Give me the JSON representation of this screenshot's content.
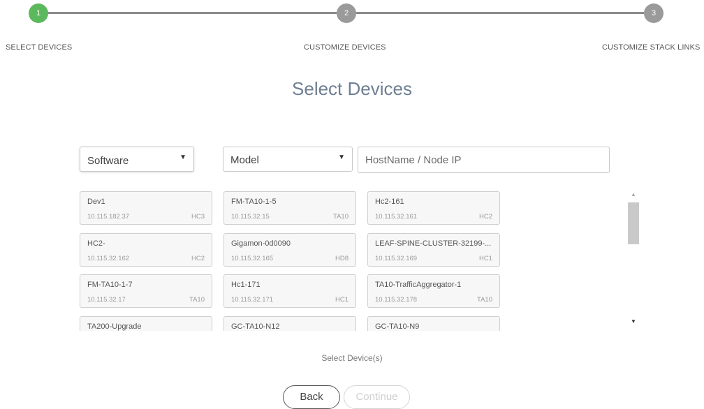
{
  "stepper": {
    "steps": [
      {
        "number": "1",
        "label": "SELECT DEVICES",
        "state": "active"
      },
      {
        "number": "2",
        "label": "CUSTOMIZE DEVICES",
        "state": "inactive"
      },
      {
        "number": "3",
        "label": "CUSTOMIZE STACK LINKS",
        "state": "inactive"
      }
    ],
    "colors": {
      "active": "#5cb85c",
      "inactive": "#9a9a9a"
    }
  },
  "page_title": "Select Devices",
  "filters": {
    "software": {
      "value": "Software",
      "icon": "caret-down-icon"
    },
    "model": {
      "value": "Model",
      "icon": "caret-down-icon"
    },
    "host": {
      "placeholder": "HostName / Node IP",
      "value": ""
    }
  },
  "devices": [
    {
      "name": "Dev1",
      "ip": "10.115.182.37",
      "model": "HC3"
    },
    {
      "name": "FM-TA10-1-5",
      "ip": "10.115.32.15",
      "model": "TA10"
    },
    {
      "name": "Hc2-161",
      "ip": "10.115.32.161",
      "model": "HC2"
    },
    {
      "name": "HC2-",
      "ip": "10.115.32.162",
      "model": "HC2"
    },
    {
      "name": "Gigamon-0d0090",
      "ip": "10.115.32.165",
      "model": "HD8"
    },
    {
      "name": "LEAF-SPINE-CLUSTER-32199-...",
      "ip": "10.115.32.169",
      "model": "HC1"
    },
    {
      "name": "FM-TA10-1-7",
      "ip": "10.115.32.17",
      "model": "TA10"
    },
    {
      "name": "Hc1-171",
      "ip": "10.115.32.171",
      "model": "HC1"
    },
    {
      "name": "TA10-TrafficAggregator-1",
      "ip": "10.115.32.178",
      "model": "TA10"
    },
    {
      "name": "TA200-Upgrade",
      "ip": "",
      "model": ""
    },
    {
      "name": "GC-TA10-N12",
      "ip": "",
      "model": ""
    },
    {
      "name": "GC-TA10-N9",
      "ip": "",
      "model": ""
    }
  ],
  "scrollbar": {
    "up_icon": "triangle-up-icon",
    "down_icon": "triangle-down-icon"
  },
  "hint": "Select Device(s)",
  "buttons": {
    "back": "Back",
    "continue": "Continue"
  }
}
